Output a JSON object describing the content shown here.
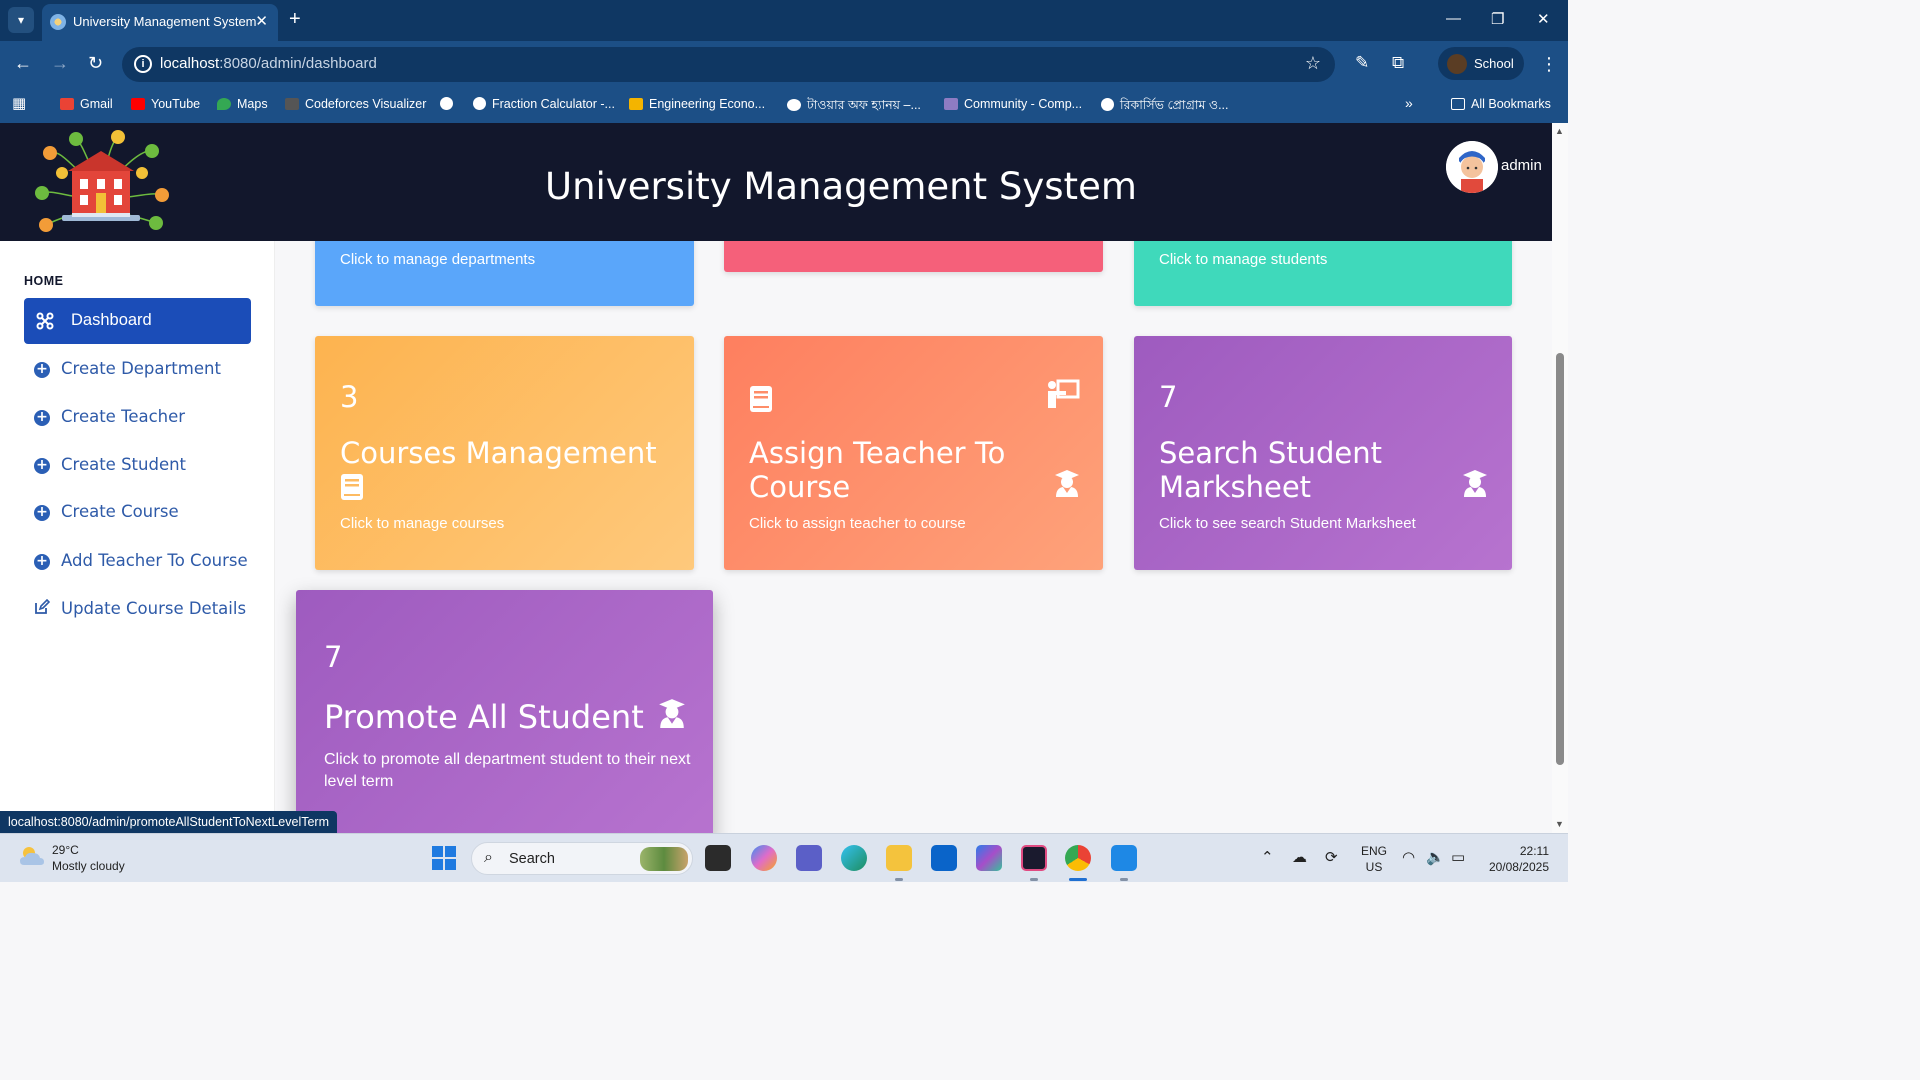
{
  "browser": {
    "tab_title": "University Management System",
    "url_host": "localhost",
    "url_path": ":8080/admin/dashboard",
    "profile_name": "School",
    "bookmarks": [
      {
        "label": "Gmail",
        "color": "#ea4335"
      },
      {
        "label": "YouTube",
        "color": "#ff0000"
      },
      {
        "label": "Maps",
        "color": "#34a853"
      },
      {
        "label": "Codeforces Visualizer",
        "color": "#555555"
      },
      {
        "label": "",
        "color": "#ffffff"
      },
      {
        "label": "Fraction Calculator -...",
        "color": "#ffffff"
      },
      {
        "label": "Engineering Econo...",
        "color": "#f4b400"
      },
      {
        "label": "টাওয়ার অফ হ্যানয় –...",
        "color": "#ffffff"
      },
      {
        "label": "Community - Comp...",
        "color": "#8e7cc3"
      },
      {
        "label": "রিকার্সিভ প্রোগ্রাম ও...",
        "color": "#ffffff"
      }
    ],
    "all_bookmarks": "All Bookmarks",
    "status_url": "localhost:8080/admin/promoteAllStudentToNextLevelTerm"
  },
  "header": {
    "title": "University Management System",
    "user": "admin"
  },
  "sidebar": {
    "section": "HOME",
    "active": "Dashboard",
    "items": [
      {
        "label": "Create Department",
        "icon": "plus-circle-icon"
      },
      {
        "label": "Create Teacher",
        "icon": "plus-circle-icon"
      },
      {
        "label": "Create Student",
        "icon": "plus-circle-icon"
      },
      {
        "label": "Create Course",
        "icon": "plus-circle-icon"
      },
      {
        "label": "Add Teacher To Course",
        "icon": "plus-circle-icon"
      },
      {
        "label": "Update Course Details",
        "icon": "edit-icon"
      }
    ]
  },
  "cards": {
    "departments": {
      "subtitle": "Click to manage departments",
      "color": "#5aa6fa"
    },
    "teachers": {
      "color": "#f5607a"
    },
    "students": {
      "subtitle": "Click to manage students",
      "color": "#3fd9bb"
    },
    "courses": {
      "count": "3",
      "title": "Courses Management",
      "subtitle": "Click to manage courses",
      "color": "#fdb85f"
    },
    "assign": {
      "title": "Assign Teacher To Course",
      "subtitle": "Click to assign teacher to course",
      "color": "#fe8d68"
    },
    "marksheet": {
      "count": "7",
      "title": "Search Student Marksheet",
      "subtitle": "Click to see search Student Marksheet",
      "color": "#a865c9"
    },
    "promote": {
      "count": "7",
      "title": "Promote All Student",
      "subtitle": "Click to promote all department student to their next level term",
      "color": "#a865c9"
    }
  },
  "taskbar": {
    "temperature": "29°C",
    "weather": "Mostly cloudy",
    "search_placeholder": "Search",
    "lang_top": "ENG",
    "lang_bottom": "US",
    "time": "22:11",
    "date": "20/08/2025"
  }
}
